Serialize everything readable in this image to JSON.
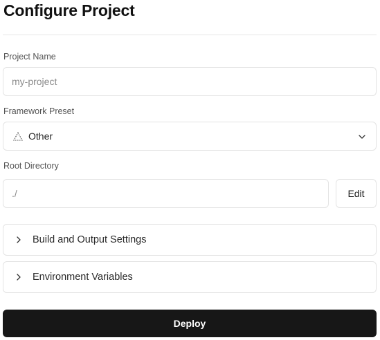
{
  "page": {
    "title": "Configure Project"
  },
  "form": {
    "project_name": {
      "label": "Project Name",
      "placeholder": "my-project"
    },
    "framework_preset": {
      "label": "Framework Preset",
      "selected": "Other",
      "icon": "triangle-dotted-icon",
      "dropdown_icon": "chevron-down-icon"
    },
    "root_directory": {
      "label": "Root Directory",
      "value": "./",
      "edit_label": "Edit"
    }
  },
  "sections": [
    {
      "label": "Build and Output Settings",
      "icon": "chevron-right-icon"
    },
    {
      "label": "Environment Variables",
      "icon": "chevron-right-icon"
    }
  ],
  "actions": {
    "deploy_label": "Deploy"
  },
  "colors": {
    "primary_button_bg": "#171717",
    "primary_button_text": "#ffffff",
    "border": "#e3e3e3"
  }
}
